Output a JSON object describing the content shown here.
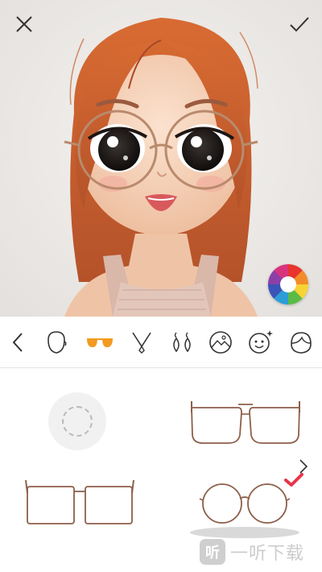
{
  "toolbar": {
    "close_icon": "close-icon",
    "confirm_icon": "checkmark-icon"
  },
  "editor": {
    "color_picker_icon": "color-wheel-icon",
    "colors": {
      "hair": "#c9602c",
      "skin": "#f2cdb1",
      "frame": "#b98a6d",
      "accent": "#e8344a"
    }
  },
  "categories": [
    {
      "icon": "chevron-left-icon"
    },
    {
      "icon": "face-shape-icon"
    },
    {
      "icon": "glasses-icon",
      "selected": true
    },
    {
      "icon": "necklace-icon"
    },
    {
      "icon": "earrings-icon"
    },
    {
      "icon": "background-icon"
    },
    {
      "icon": "smile-sparkle-icon"
    },
    {
      "icon": "hair-icon"
    }
  ],
  "glasses_options": [
    {
      "icon": "no-glasses-icon",
      "style": "none"
    },
    {
      "icon": "aviator-glasses-icon",
      "style": "aviator"
    },
    {
      "icon": "square-glasses-icon",
      "style": "square"
    },
    {
      "icon": "round-glasses-icon",
      "style": "round",
      "selected": true
    }
  ],
  "pager": {
    "next_icon": "chevron-right-icon"
  },
  "watermark": {
    "logo_text": "听",
    "text": "一听下载"
  }
}
